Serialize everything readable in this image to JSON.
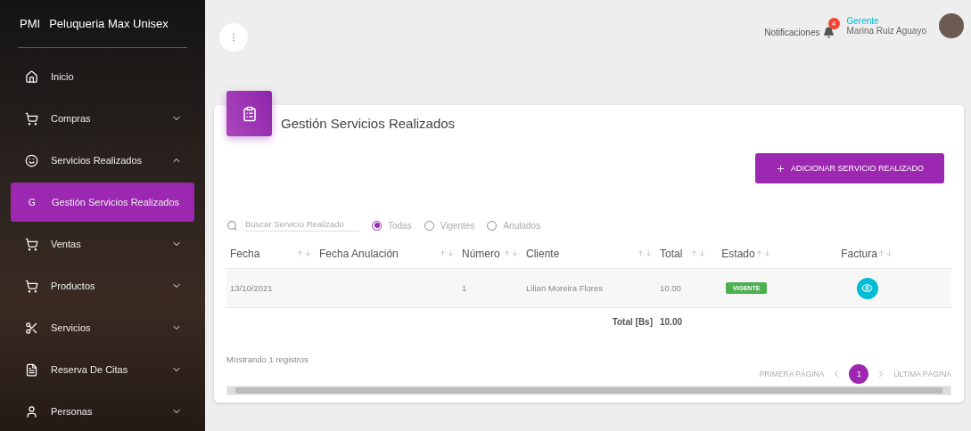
{
  "sidebar": {
    "logo": "PMI",
    "brand": "Peluqueria Max Unisex",
    "items": [
      {
        "kind": "link",
        "label": "Inicio",
        "selected": false
      },
      {
        "kind": "group",
        "label": "Compras",
        "expanded": false,
        "selected": false
      },
      {
        "kind": "group",
        "label": "Servicios Realizados",
        "expanded": true,
        "selected": false
      },
      {
        "kind": "subitem",
        "mark": "G",
        "label": "Gestión Servicios Realizados",
        "selected": true
      },
      {
        "kind": "group",
        "label": "Ventas",
        "expanded": false,
        "selected": false
      },
      {
        "kind": "group",
        "label": "Productos",
        "expanded": false,
        "selected": false
      },
      {
        "kind": "group",
        "label": "Servicios",
        "expanded": false,
        "selected": false
      },
      {
        "kind": "group",
        "label": "Reserva De Citas",
        "expanded": false,
        "selected": false
      },
      {
        "kind": "group",
        "label": "Personas",
        "expanded": false,
        "selected": false
      }
    ]
  },
  "topbar": {
    "notifications": {
      "label": "Notificaciones",
      "count": "4"
    },
    "user": {
      "role": "Gerente",
      "name": "Marina Ruiz Aguayo"
    }
  },
  "card": {
    "title": "Gestión Servicios Realizados",
    "add_button": "ADICIONAR SERVICIO REALIZADO",
    "search": {
      "placeholder": "Buscar Servicio Realizado"
    },
    "filters": [
      {
        "label": "Todas",
        "selected": true
      },
      {
        "label": "Vigentes",
        "selected": false
      },
      {
        "label": "Anulados",
        "selected": false
      }
    ],
    "table": {
      "columns": [
        {
          "label": "Fecha"
        },
        {
          "label": "Fecha Anulación"
        },
        {
          "label": "Número"
        },
        {
          "label": "Cliente"
        },
        {
          "label": "Total"
        },
        {
          "label": "Estado"
        },
        {
          "label": "Factura"
        }
      ],
      "rows": [
        {
          "fecha": "13/10/2021",
          "numero": "1",
          "cliente": "Lilian Moreira Flores",
          "total": "10.00",
          "estado": "VIGENTE"
        }
      ],
      "footer": {
        "label": "Total [Bs]",
        "value": "10.00"
      }
    },
    "record_count": "Mostrando 1 registros",
    "pagination": {
      "first": "PRIMERA PÁGINA",
      "last": "ÚLTIMA PÁGINA",
      "pages": [
        {
          "label": "1",
          "selected": true
        }
      ]
    }
  }
}
